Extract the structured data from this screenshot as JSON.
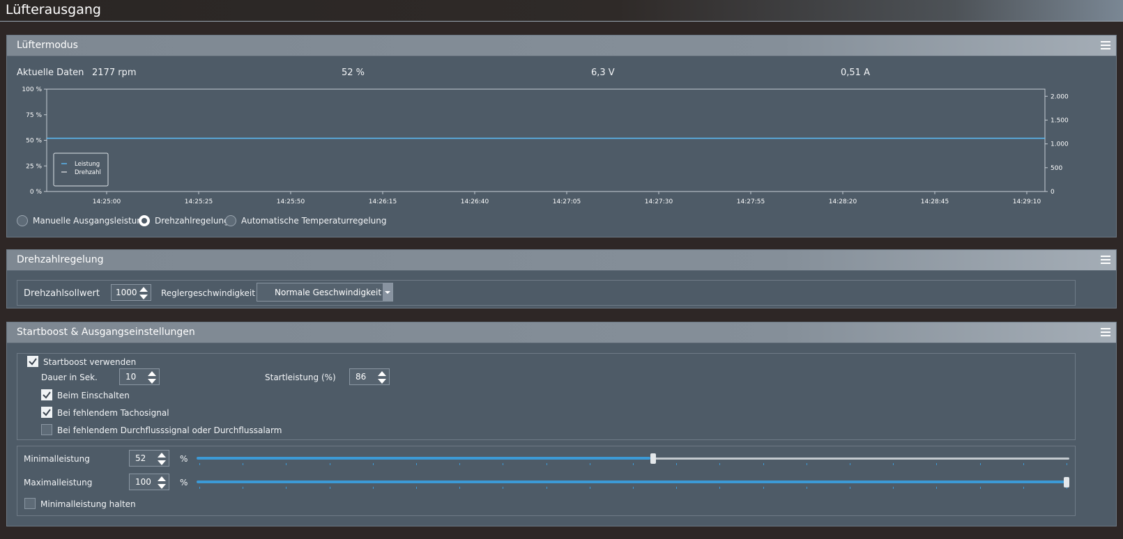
{
  "window": {
    "title": "Lüfterausgang"
  },
  "fan_mode": {
    "title": "Lüftermodus",
    "current_label": "Aktuelle Daten",
    "rpm": "2177 rpm",
    "percent": "52 %",
    "voltage": "6,3 V",
    "current": "0,51 A",
    "modes": [
      {
        "label": "Manuelle Ausgangsleistung",
        "selected": false
      },
      {
        "label": "Drehzahlregelung",
        "selected": true
      },
      {
        "label": "Automatische Temperaturregelung",
        "selected": false
      }
    ]
  },
  "chart_data": {
    "type": "line",
    "x": [
      "14:25:00",
      "14:25:25",
      "14:25:50",
      "14:26:15",
      "14:26:40",
      "14:27:05",
      "14:27:30",
      "14:27:55",
      "14:28:20",
      "14:28:45",
      "14:29:10"
    ],
    "y_left_ticks": [
      "100 %",
      "75 %",
      "50 %",
      "25 %",
      "0 %"
    ],
    "y_right_ticks": [
      "2.000",
      "1.500",
      "1.000",
      "500",
      "0"
    ],
    "ylim_left": [
      0,
      100
    ],
    "ylim_right": [
      0,
      2150
    ],
    "series": [
      {
        "name": "Leistung",
        "axis": "left",
        "color": "#5bb8f0",
        "values": [
          52,
          52,
          52,
          52,
          52,
          52,
          52,
          52,
          52,
          52,
          52
        ]
      },
      {
        "name": "Drehzahl",
        "axis": "right",
        "color": "#c9cdd1",
        "values": []
      }
    ],
    "legend_position": "bottom-left",
    "grid": false
  },
  "speed_control": {
    "title": "Drehzahlregelung",
    "setpoint_label": "Drehzahlsollwert",
    "setpoint_value": "1000",
    "speed_label": "Reglergeschwindigkeit",
    "speed_selected": "Normale Geschwindigkeit"
  },
  "boost": {
    "title": "Startboost & Ausgangseinstellungen",
    "use_boost_label": "Startboost verwenden",
    "use_boost_checked": true,
    "duration_label": "Dauer in Sek.",
    "duration_value": "10",
    "start_power_label": "Startleistung (%)",
    "start_power_value": "86",
    "options": [
      {
        "label": "Beim Einschalten",
        "checked": true
      },
      {
        "label": "Bei fehlendem Tachosignal",
        "checked": true
      },
      {
        "label": "Bei fehlendem Durchflusssignal oder Durchflussalarm",
        "checked": false
      }
    ],
    "min_label": "Minimalleistung",
    "min_value": "52",
    "max_label": "Maximalleistung",
    "max_value": "100",
    "percent_unit": "%",
    "min_fraction": 0.52,
    "max_fraction": 1.0,
    "hold_min_label": "Minimalleistung halten",
    "hold_min_checked": false
  },
  "colors": {
    "accent": "#3c9ad6",
    "panel": "#4e5b67",
    "background": "#2e2726"
  }
}
